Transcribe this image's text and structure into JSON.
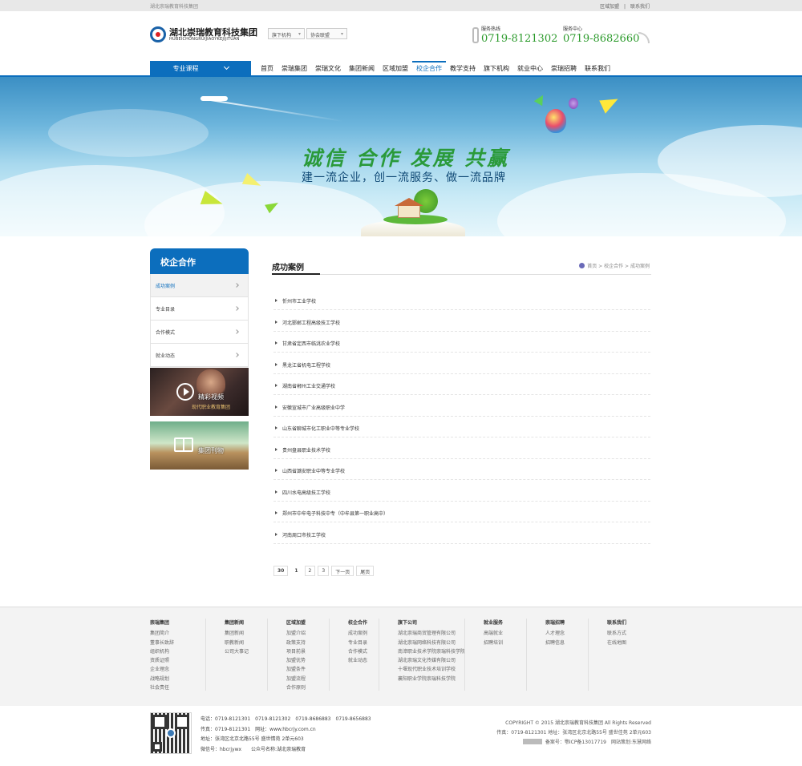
{
  "topbar": {
    "site_name": "湖北崇瑞教育科技集团",
    "links": [
      "区域加盟",
      "|",
      "联系我们"
    ]
  },
  "header": {
    "logo_cn": "湖北崇瑞教育科技集团",
    "logo_en": "HUBEICHONGRUIJIAOYKEJIJITUAN",
    "dropdowns": [
      "旗下机构",
      "协会联盟"
    ],
    "hotline_label": "服务热线",
    "hotline": "0719-8121302",
    "service_label": "服务中心",
    "service": "0719-8682660"
  },
  "nav": {
    "category_button": "专业课程",
    "items": [
      "首页",
      "崇瑞集团",
      "崇瑞文化",
      "集团新闻",
      "区域加盟",
      "校企合作",
      "教学支持",
      "旗下机构",
      "就业中心",
      "崇瑞招聘",
      "联系我们"
    ],
    "active_index": 5
  },
  "banner": {
    "slogan": "诚信 合作 发展 共赢",
    "subslogan": "建一流企业，创一流服务、做一流品牌"
  },
  "sidebar": {
    "title": "校企合作",
    "items": [
      "成功案例",
      "专业目录",
      "合作模式",
      "就业动态"
    ],
    "active_index": 0,
    "promo_video": "精彩视频",
    "promo_video_sub": "现代职业教育集团",
    "promo_magazine": "集团刊物"
  },
  "main": {
    "title": "成功案例",
    "breadcrumb": [
      "首页",
      ">",
      "校企合作",
      ">",
      "成功案例"
    ],
    "list": [
      "忻州市工业学校",
      "河北邯郸工程高级技工学校",
      "甘肃省定西市临洮农业学校",
      "黑龙江省机电工程学校",
      "湖南省郴州工业交通学校",
      "安徽宣城市广业高级职业中学",
      "山东省聊城市化工职业中等专业学校",
      "贵州盘县职业技术学校",
      "山西省潞安职业中等专业学校",
      "四川水电高级技工学校",
      "郑州市中牟电子科技中专（中牟县第一职业高中）",
      "河南周口市技工学校"
    ],
    "pager": {
      "total": "30",
      "pages": [
        "1",
        "2",
        "3"
      ],
      "current": "1",
      "next": "下一页",
      "last": "尾页"
    }
  },
  "footer": {
    "columns": [
      {
        "head": "崇瑞集团",
        "items": [
          "集团简介",
          "董事长致辞",
          "组织机构",
          "资质证照",
          "企业理念",
          "战略规划",
          "社会责任"
        ]
      },
      {
        "head": "集团新闻",
        "items": [
          "集团新闻",
          "职教新闻",
          "公司大事记"
        ]
      },
      {
        "head": "区域加盟",
        "items": [
          "加盟介绍",
          "政策支持",
          "项目前景",
          "加盟优势",
          "加盟条件",
          "加盟流程",
          "合作原则"
        ]
      },
      {
        "head": "校企合作",
        "items": [
          "成功案例",
          "专业目录",
          "合作模式",
          "就业动态"
        ]
      },
      {
        "head": "旗下公司",
        "items": [
          "湖北崇瑞商贸管理有限公司",
          "湖北崇瑞网络科技有限公司",
          "南漳职业技术学院崇瑞科技学院",
          "湖北崇瑞文化传媒有限公司",
          "十堰现代职业技术培训学校",
          "襄阳职业学院崇瑞科技学院"
        ]
      },
      {
        "head": "就业服务",
        "items": [
          "高端就业",
          "招聘培训"
        ]
      },
      {
        "head": "崇瑞招聘",
        "items": [
          "人才理念",
          "招聘信息"
        ]
      },
      {
        "head": "联系我们",
        "items": [
          "联系方式",
          "在线地图"
        ]
      }
    ],
    "contact": [
      "电话：0719-8121301　0719-8121302　0719-8686883　0719-8656883",
      "传真：0719-8121301　网址：www.hbcrjy.com.cn",
      "地址：张湾区北京北路55号 盛世情苑 2单元603",
      "微信号：hbcrjywx　　公众号名称:湖北崇瑞教育"
    ],
    "copyright": "COPYRIGHT © 2015 湖北崇瑞教育科技集团  All Rights Reserved",
    "fax_address": "传真：0719-8121301  地址：张湾区北京北路55号 盛世佳苑 2单元603",
    "icp": "备案号：鄂ICP备13017719　网站策划:东慧网络"
  }
}
